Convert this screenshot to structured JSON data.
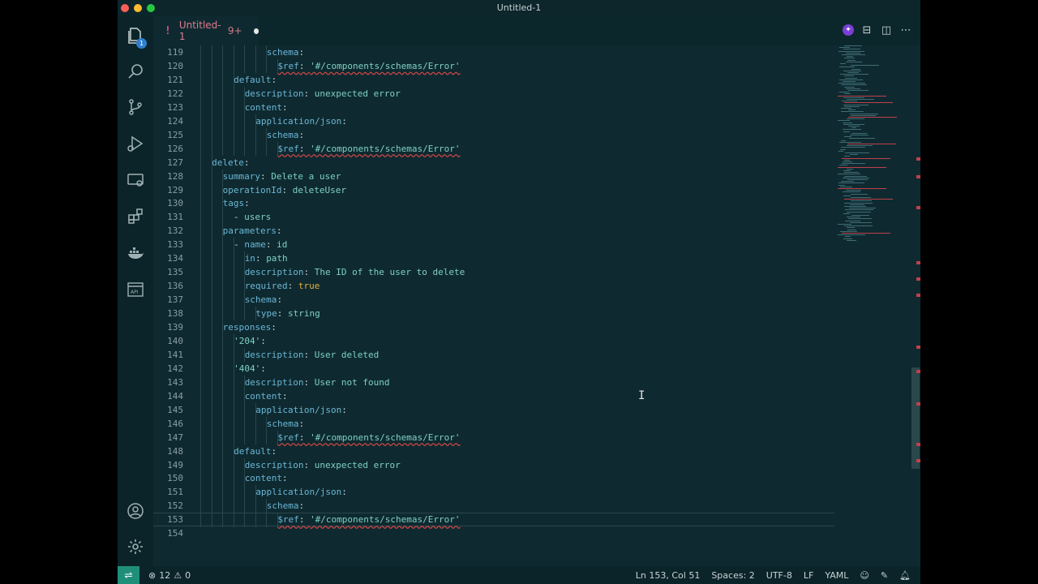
{
  "window": {
    "title": "Untitled-1"
  },
  "tab": {
    "icon": "!",
    "name": "Untitled-1",
    "problem_count": "9+"
  },
  "activity_bar": {
    "explorer_badge": "1",
    "items": [
      "files-icon",
      "search-icon",
      "source-control-icon",
      "run-debug-icon",
      "remote-explorer-icon",
      "extensions-icon",
      "docker-icon",
      "api-icon"
    ],
    "bottom": [
      "account-icon",
      "settings-gear-icon"
    ]
  },
  "editor": {
    "lines": [
      {
        "n": "119",
        "indent": 7,
        "segs": [
          [
            "k",
            "schema"
          ],
          [
            "p",
            ":"
          ]
        ]
      },
      {
        "n": "120",
        "indent": 8,
        "segs": [
          [
            "k",
            "$ref",
            "err"
          ],
          [
            "p",
            ": ",
            "err"
          ],
          [
            "s",
            "'#/components/schemas/Error'",
            "err"
          ]
        ]
      },
      {
        "n": "121",
        "indent": 4,
        "segs": [
          [
            "k",
            "default"
          ],
          [
            "p",
            ":"
          ]
        ]
      },
      {
        "n": "122",
        "indent": 5,
        "segs": [
          [
            "k",
            "description"
          ],
          [
            "p",
            ": "
          ],
          [
            "v",
            "unexpected error"
          ]
        ]
      },
      {
        "n": "123",
        "indent": 5,
        "segs": [
          [
            "k",
            "content"
          ],
          [
            "p",
            ":"
          ]
        ]
      },
      {
        "n": "124",
        "indent": 6,
        "segs": [
          [
            "k",
            "application/json"
          ],
          [
            "p",
            ":"
          ]
        ]
      },
      {
        "n": "125",
        "indent": 7,
        "segs": [
          [
            "k",
            "schema"
          ],
          [
            "p",
            ":"
          ]
        ]
      },
      {
        "n": "126",
        "indent": 8,
        "segs": [
          [
            "k",
            "$ref",
            "err"
          ],
          [
            "p",
            ": ",
            "err"
          ],
          [
            "s",
            "'#/components/schemas/Error'",
            "err"
          ]
        ]
      },
      {
        "n": "127",
        "indent": 2,
        "segs": [
          [
            "k",
            "delete"
          ],
          [
            "p",
            ":"
          ]
        ]
      },
      {
        "n": "128",
        "indent": 3,
        "segs": [
          [
            "k",
            "summary"
          ],
          [
            "p",
            ": "
          ],
          [
            "v",
            "Delete a user"
          ]
        ]
      },
      {
        "n": "129",
        "indent": 3,
        "segs": [
          [
            "k",
            "operationId"
          ],
          [
            "p",
            ": "
          ],
          [
            "v",
            "deleteUser"
          ]
        ]
      },
      {
        "n": "130",
        "indent": 3,
        "segs": [
          [
            "k",
            "tags"
          ],
          [
            "p",
            ":"
          ]
        ]
      },
      {
        "n": "131",
        "indent": 3,
        "segs": [
          [
            "p",
            "  - "
          ],
          [
            "v",
            "users"
          ]
        ]
      },
      {
        "n": "132",
        "indent": 3,
        "segs": [
          [
            "k",
            "parameters"
          ],
          [
            "p",
            ":"
          ]
        ]
      },
      {
        "n": "133",
        "indent": 4,
        "segs": [
          [
            "p",
            "- "
          ],
          [
            "k",
            "name"
          ],
          [
            "p",
            ": "
          ],
          [
            "v",
            "id"
          ]
        ]
      },
      {
        "n": "134",
        "indent": 5,
        "segs": [
          [
            "k",
            "in"
          ],
          [
            "p",
            ": "
          ],
          [
            "v",
            "path"
          ]
        ]
      },
      {
        "n": "135",
        "indent": 5,
        "segs": [
          [
            "k",
            "description"
          ],
          [
            "p",
            ": "
          ],
          [
            "v",
            "The ID of the user to delete"
          ]
        ]
      },
      {
        "n": "136",
        "indent": 5,
        "segs": [
          [
            "k",
            "required"
          ],
          [
            "p",
            ": "
          ],
          [
            "b",
            "true"
          ]
        ]
      },
      {
        "n": "137",
        "indent": 5,
        "segs": [
          [
            "k",
            "schema"
          ],
          [
            "p",
            ":"
          ]
        ]
      },
      {
        "n": "138",
        "indent": 6,
        "segs": [
          [
            "k",
            "type"
          ],
          [
            "p",
            ": "
          ],
          [
            "v",
            "string"
          ]
        ]
      },
      {
        "n": "139",
        "indent": 3,
        "segs": [
          [
            "k",
            "responses"
          ],
          [
            "p",
            ":"
          ]
        ]
      },
      {
        "n": "140",
        "indent": 4,
        "segs": [
          [
            "s",
            "'204'"
          ],
          [
            "p",
            ":"
          ]
        ]
      },
      {
        "n": "141",
        "indent": 5,
        "segs": [
          [
            "k",
            "description"
          ],
          [
            "p",
            ": "
          ],
          [
            "v",
            "User deleted"
          ]
        ]
      },
      {
        "n": "142",
        "indent": 4,
        "segs": [
          [
            "s",
            "'404'"
          ],
          [
            "p",
            ":"
          ]
        ]
      },
      {
        "n": "143",
        "indent": 5,
        "segs": [
          [
            "k",
            "description"
          ],
          [
            "p",
            ": "
          ],
          [
            "v",
            "User not found"
          ]
        ]
      },
      {
        "n": "144",
        "indent": 5,
        "segs": [
          [
            "k",
            "content"
          ],
          [
            "p",
            ":"
          ]
        ]
      },
      {
        "n": "145",
        "indent": 6,
        "segs": [
          [
            "k",
            "application/json"
          ],
          [
            "p",
            ":"
          ]
        ]
      },
      {
        "n": "146",
        "indent": 7,
        "segs": [
          [
            "k",
            "schema"
          ],
          [
            "p",
            ":"
          ]
        ]
      },
      {
        "n": "147",
        "indent": 8,
        "segs": [
          [
            "k",
            "$ref",
            "err"
          ],
          [
            "p",
            ": ",
            "err"
          ],
          [
            "s",
            "'#/components/schemas/Error'",
            "err"
          ]
        ]
      },
      {
        "n": "148",
        "indent": 4,
        "segs": [
          [
            "k",
            "default"
          ],
          [
            "p",
            ":"
          ]
        ]
      },
      {
        "n": "149",
        "indent": 5,
        "segs": [
          [
            "k",
            "description"
          ],
          [
            "p",
            ": "
          ],
          [
            "v",
            "unexpected error"
          ]
        ]
      },
      {
        "n": "150",
        "indent": 5,
        "segs": [
          [
            "k",
            "content"
          ],
          [
            "p",
            ":"
          ]
        ]
      },
      {
        "n": "151",
        "indent": 6,
        "segs": [
          [
            "k",
            "application/json"
          ],
          [
            "p",
            ":"
          ]
        ]
      },
      {
        "n": "152",
        "indent": 7,
        "segs": [
          [
            "k",
            "schema"
          ],
          [
            "p",
            ":"
          ]
        ]
      },
      {
        "n": "153",
        "indent": 8,
        "current": true,
        "segs": [
          [
            "k",
            "$ref",
            "err"
          ],
          [
            "p",
            ": ",
            "err"
          ],
          [
            "s",
            "'#/components/schemas/Error'",
            "err"
          ]
        ]
      },
      {
        "n": "154",
        "indent": 0,
        "segs": []
      }
    ]
  },
  "status": {
    "errors": "12",
    "warnings": "0",
    "position": "Ln 153, Col 51",
    "spaces": "Spaces: 2",
    "encoding": "UTF-8",
    "eol": "LF",
    "language": "YAML"
  },
  "colors": {
    "editor_bg": "#0e2a30",
    "remote_accent": "#1f8f7a",
    "error": "#e04848",
    "tab_modified": "#e07a8f"
  }
}
